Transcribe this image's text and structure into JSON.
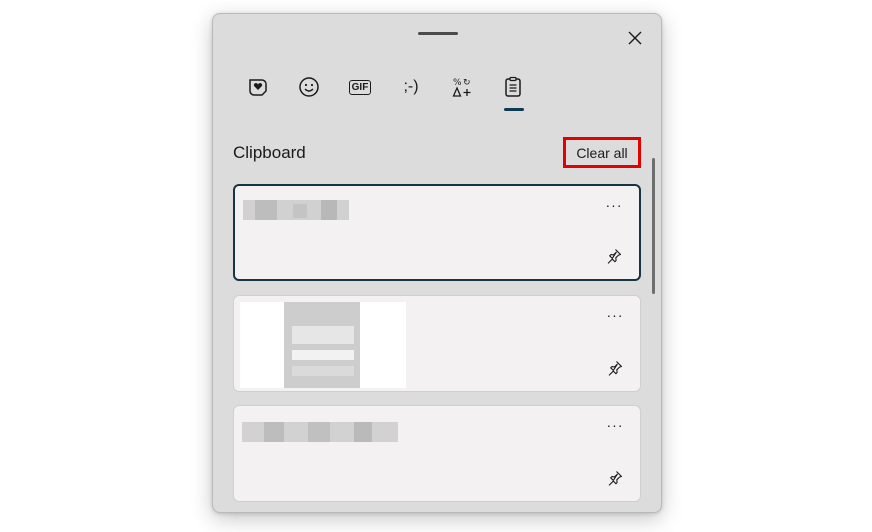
{
  "panel": {
    "tabs": [
      {
        "name": "tab-kaomoji-favorites",
        "icon": "heart-sticker-icon"
      },
      {
        "name": "tab-emoji",
        "icon": "smiley-icon"
      },
      {
        "name": "tab-gif",
        "icon": "gif-icon",
        "label": "GIF"
      },
      {
        "name": "tab-kaomoji",
        "icon": "kaomoji-icon",
        "label": ";-)"
      },
      {
        "name": "tab-symbols",
        "icon": "symbols-icon"
      },
      {
        "name": "tab-clipboard",
        "icon": "clipboard-icon",
        "active": true
      }
    ],
    "section_title": "Clipboard",
    "clear_label": "Clear all",
    "more_label": "···",
    "items": [
      {
        "type": "text",
        "selected": true
      },
      {
        "type": "image",
        "selected": false
      },
      {
        "type": "text",
        "selected": false
      }
    ],
    "colors": {
      "accent": "#0f3b52",
      "highlight": "#e30000",
      "panel": "#dcdcdc",
      "card": "#f3f1f2"
    }
  }
}
